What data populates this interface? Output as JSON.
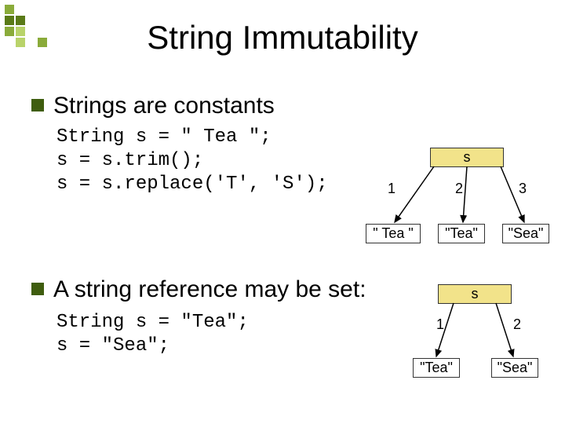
{
  "title": "String Immutability",
  "bullets": {
    "b1": "Strings are constants",
    "b2": "A string reference may be set:"
  },
  "code": {
    "block1_l1": "String s = \" Tea \";",
    "block1_l2": "s = s.trim();",
    "block1_l3": "s = s.replace('T', 'S');",
    "block2_l1": "String s = \"Tea\";",
    "block2_l2": "s = \"Sea\";"
  },
  "diagram1": {
    "var": "s",
    "steps": {
      "n1": "1",
      "n2": "2",
      "n3": "3"
    },
    "vals": {
      "v1": "\" Tea \"",
      "v2": "\"Tea\"",
      "v3": "\"Sea\""
    }
  },
  "diagram2": {
    "var": "s",
    "steps": {
      "n1": "1",
      "n2": "2"
    },
    "vals": {
      "v1": "\"Tea\"",
      "v2": "\"Sea\""
    }
  }
}
